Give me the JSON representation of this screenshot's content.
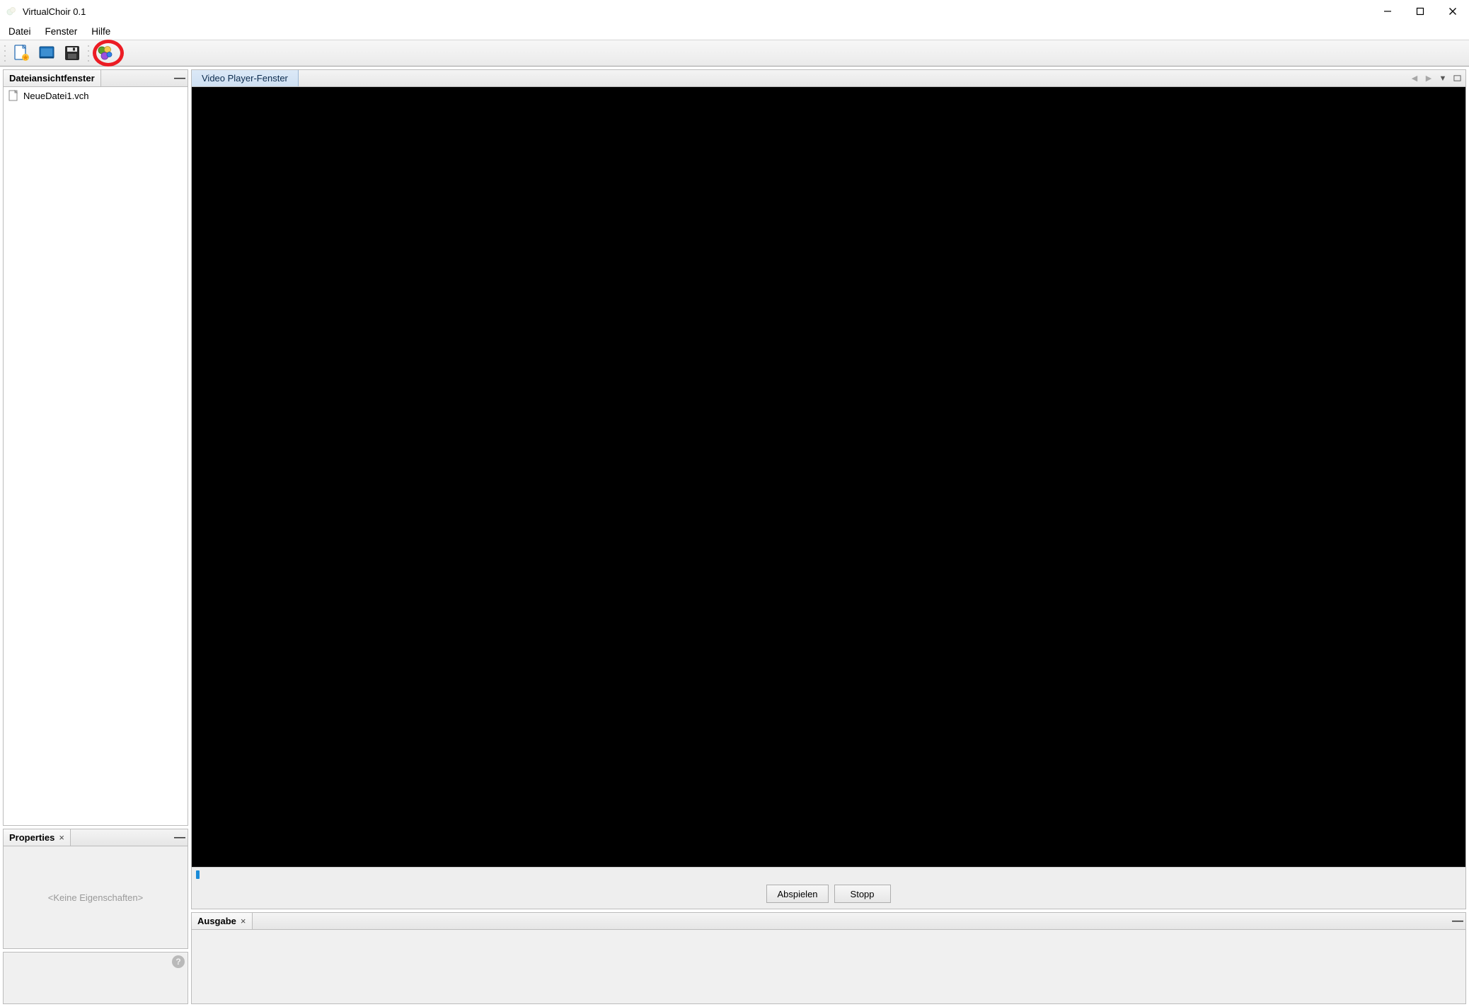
{
  "app": {
    "title": "VirtualChoir 0.1"
  },
  "menubar": {
    "file": "Datei",
    "window": "Fenster",
    "help": "Hilfe"
  },
  "toolbar": {
    "new_file": "new-file-icon",
    "open": "open-icon",
    "save": "save-icon",
    "people": "people-icon"
  },
  "left": {
    "file_view_title": "Dateiansichtfenster",
    "files": [
      {
        "name": "NeueDatei1.vch"
      }
    ],
    "properties_title": "Properties",
    "properties_empty": "<Keine Eigenschaften>"
  },
  "main": {
    "video_tab": "Video Player-Fenster",
    "play_label": "Abspielen",
    "stop_label": "Stopp"
  },
  "output": {
    "title": "Ausgabe"
  }
}
